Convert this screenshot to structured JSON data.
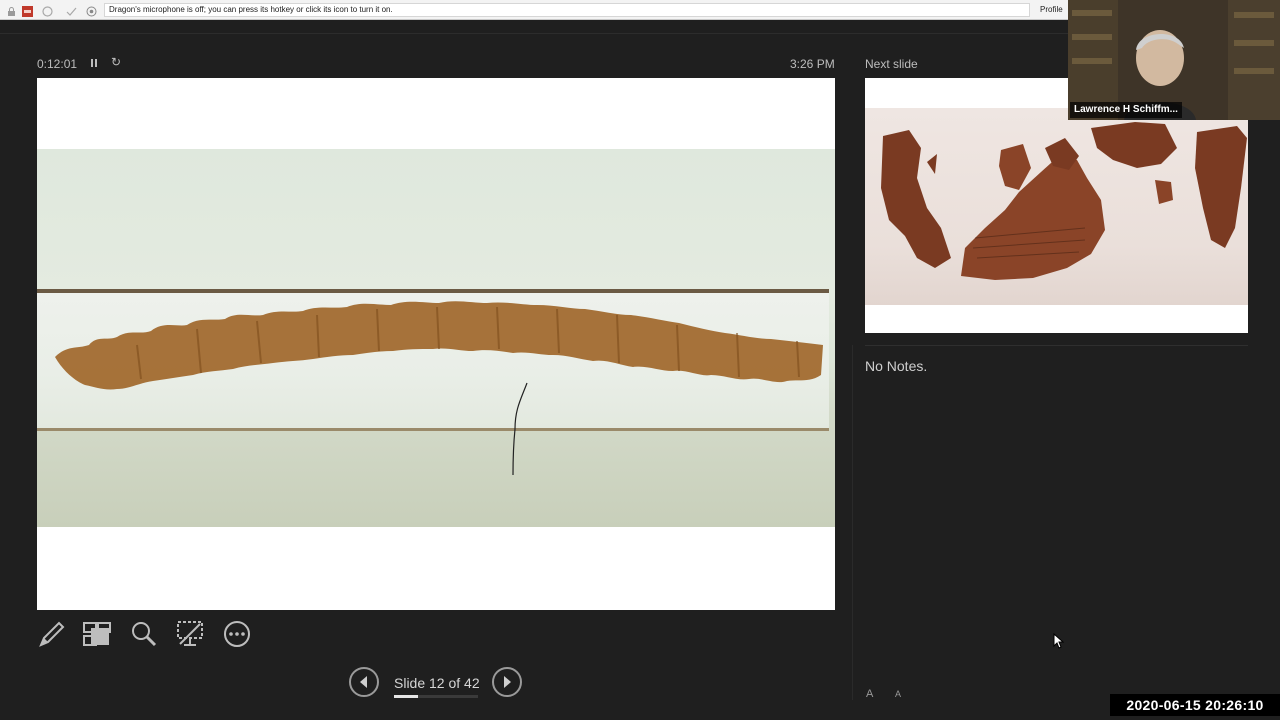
{
  "dragon_bar": {
    "message": "Dragon's microphone is off; you can press its hotkey or click its icon to turn it on.",
    "profile_label": "Profile"
  },
  "presenter": {
    "elapsed_time": "0:12:01",
    "clock": "3:26 PM",
    "next_slide_label": "Next slide",
    "notes_text": "No Notes.",
    "slide_counter": "Slide 12 of 42",
    "progress_fraction": 0.286,
    "font_increase_label": "A",
    "font_decrease_label": "A"
  },
  "video": {
    "participant_name": "Lawrence H Schiffm..."
  },
  "recording": {
    "timestamp": "2020-06-15  20:26:10"
  },
  "icons": {
    "pen": "pen-icon",
    "slides": "see-all-slides-icon",
    "zoom": "zoom-icon",
    "black_screen": "black-screen-icon",
    "more": "more-options-icon",
    "prev": "previous-slide-icon",
    "next": "next-slide-icon",
    "pause": "pause-icon",
    "reset": "reset-timer-icon"
  },
  "colors": {
    "background": "#1f1f1f",
    "text": "#cfcfcf",
    "scroll_fragments": "#a0672a",
    "next_fragments": "#7a3a22"
  }
}
